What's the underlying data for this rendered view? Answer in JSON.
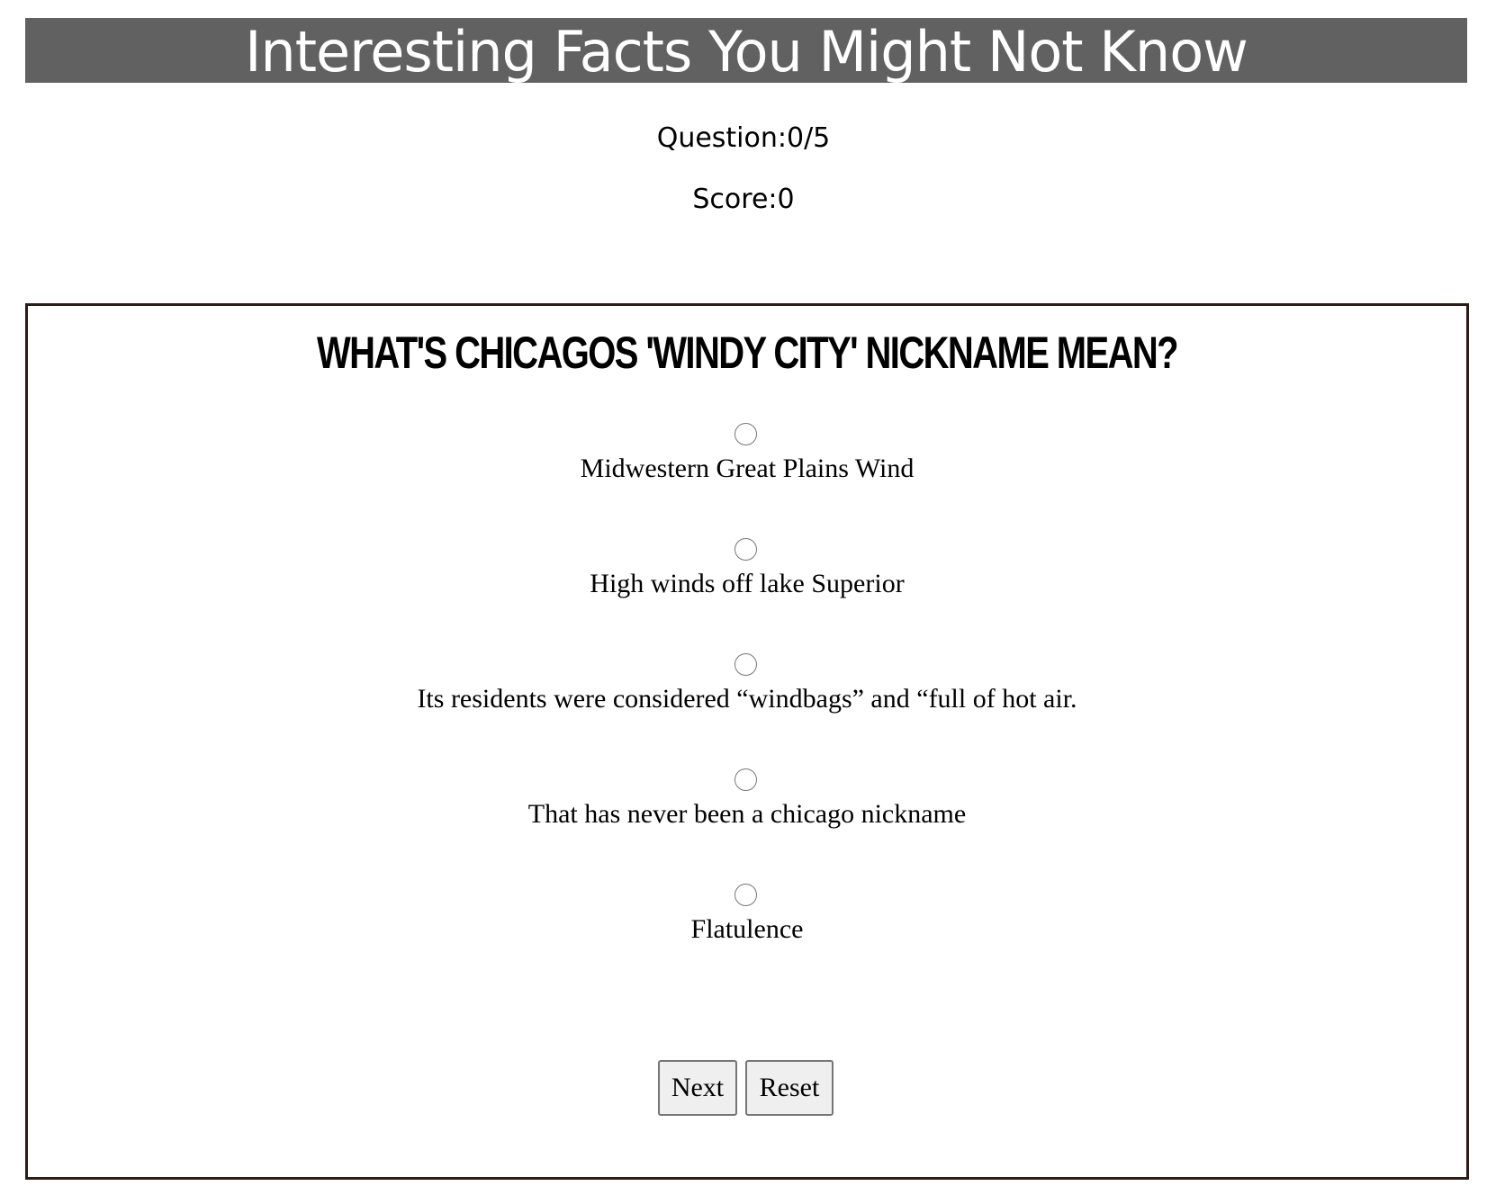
{
  "header": {
    "title": "Interesting Facts You Might Not Know"
  },
  "status": {
    "question": "Question:0/5",
    "score": "Score:0"
  },
  "quiz": {
    "question": "What's chicagos 'windy city' nickname mean?",
    "choices": [
      "Midwestern Great Plains Wind",
      "High winds off lake Superior",
      "Its residents were considered “windbags” and “full of hot air.",
      "That has never been a chicago nickname",
      "Flatulence"
    ],
    "next_label": "Next",
    "reset_label": "Reset"
  },
  "colors": {
    "title_bar_bg": "#616161",
    "box_border": "#2b1d16",
    "button_bg": "#efefef"
  }
}
